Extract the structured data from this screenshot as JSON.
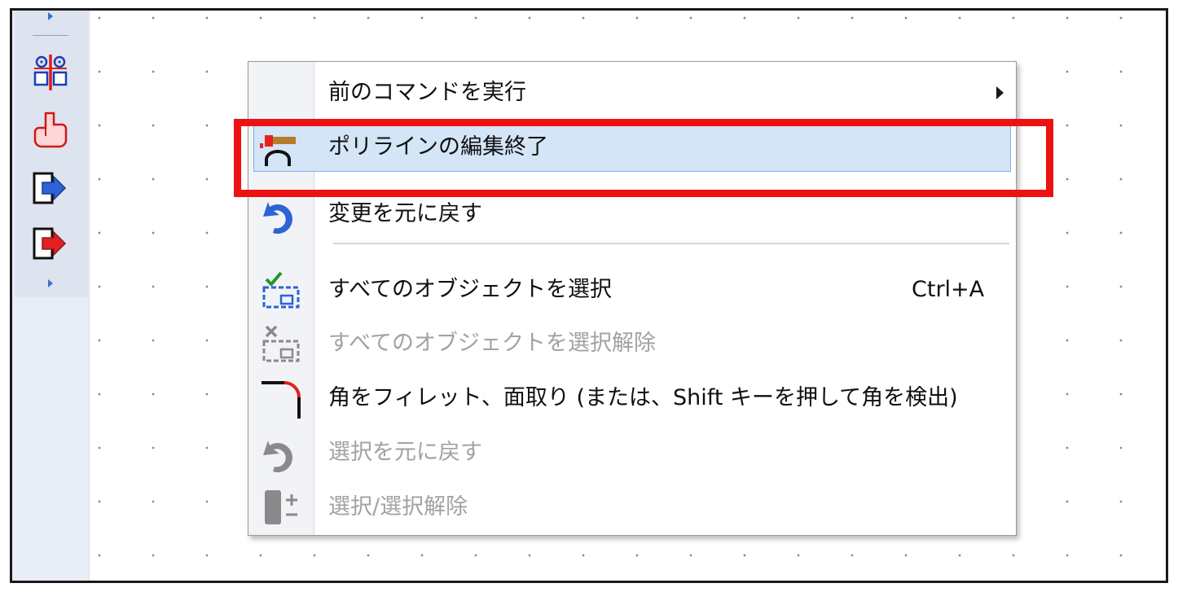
{
  "toolbar": {
    "buttons": [
      {
        "name": "align-icon"
      },
      {
        "name": "hand-pan-icon"
      },
      {
        "name": "move-in-blue-icon"
      },
      {
        "name": "move-in-red-icon"
      }
    ]
  },
  "context_menu": {
    "items": [
      {
        "label": "前のコマンドを実行",
        "has_submenu": true,
        "enabled": true
      },
      {
        "label": "ポリラインの編集終了",
        "enabled": true,
        "highlighted": true
      },
      {
        "label": "変更を元に戻す",
        "enabled": true
      },
      {
        "label": "すべてのオブジェクトを選択",
        "shortcut": "Ctrl+A",
        "enabled": true
      },
      {
        "label": "すべてのオブジェクトを選択解除",
        "enabled": false
      },
      {
        "label": "角をフィレット、面取り (または、Shift キーを押して角を検出)",
        "enabled": true
      },
      {
        "label": "選択を元に戻す",
        "enabled": false
      },
      {
        "label": "選択/選択解除",
        "enabled": false
      }
    ]
  },
  "colors": {
    "highlight_fill": "#d3e5f7",
    "highlight_border": "#7fb0e4",
    "callout": "#ee1111",
    "disabled_text": "#a2a2a2"
  }
}
